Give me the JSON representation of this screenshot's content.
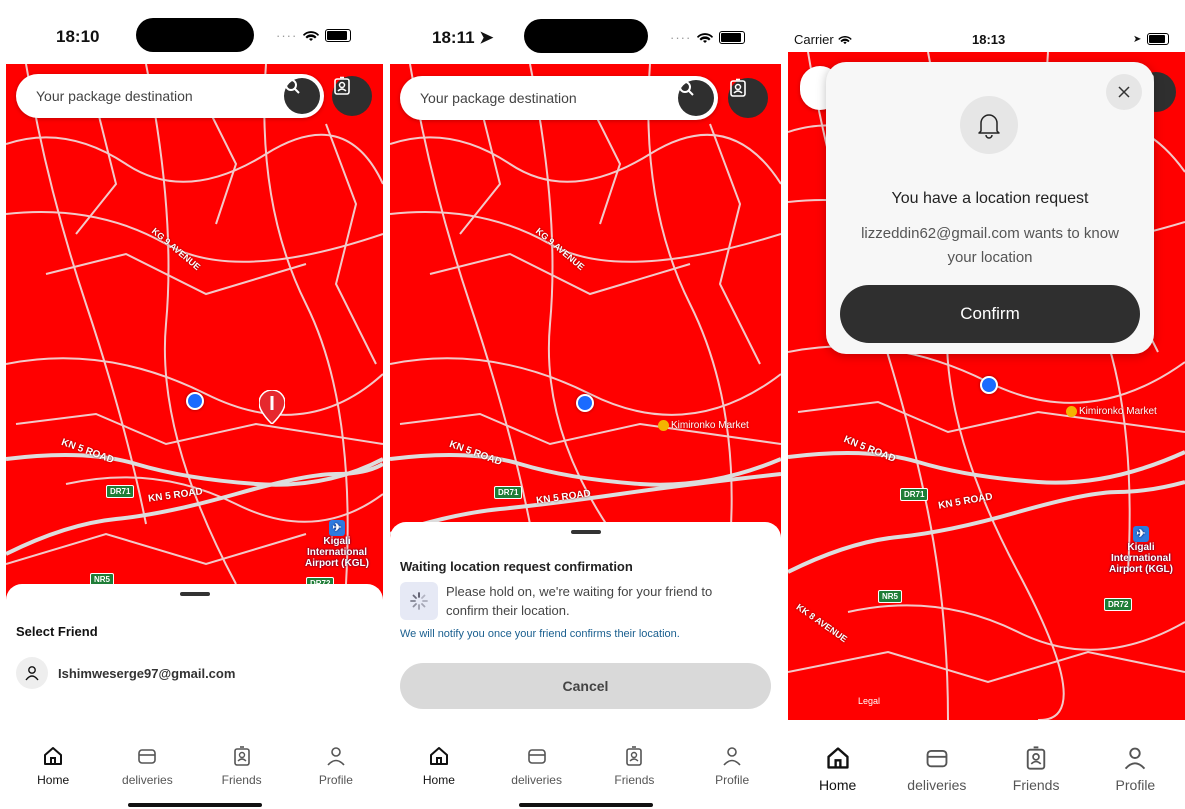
{
  "screens": [
    {
      "time": "18:10",
      "search_placeholder": "Your package destination",
      "map_labels": {
        "kn5_road_a": "KN 5 ROAD",
        "kn5_road_b": "KN 5 ROAD",
        "road_dr71": "DR71",
        "road_nr5": "NR5",
        "road_dr72": "DR72",
        "avenue": "KG 9 AVENUE",
        "airport": "Kigali International Airport (KGL)"
      },
      "sheet": {
        "title": "Select Friend",
        "friend_email": "Ishimweserge97@gmail.com"
      }
    },
    {
      "time": "18:11",
      "search_placeholder": "Your package destination",
      "map_labels": {
        "kn5_road_a": "KN 5 ROAD",
        "kn5_road_b": "KN 5 ROAD",
        "road_dr71": "DR71",
        "market": "Kimironko Market",
        "avenue": "KG 9 AVENUE"
      },
      "sheet": {
        "title": "Waiting location request confirmation",
        "message": "Please hold on, we're waiting for your friend to confirm their location.",
        "note": "We will notify you once your friend confirms their location.",
        "cancel_label": "Cancel"
      }
    },
    {
      "carrier": "Carrier",
      "time": "18:13",
      "map_labels": {
        "kn5_road_a": "KN 5 ROAD",
        "kn5_road_b": "KN 5 ROAD",
        "road_dr71": "DR71",
        "road_nr5": "NR5",
        "road_dr72": "DR72",
        "market": "Kimironko Market",
        "airport": "Kigali International Airport (KGL)",
        "legal": "Legal",
        "avenue": "KK 8 AVENUE"
      },
      "modal": {
        "title": "You have a location request",
        "message": "lizzeddin62@gmail.com wants to know your location",
        "confirm_label": "Confirm"
      }
    }
  ],
  "tabs": [
    "Home",
    "deliveries",
    "Friends",
    "Profile"
  ],
  "colors": {
    "map": "#ff0000",
    "dark_button": "#2f2f2f",
    "link_blue": "#1a5f8f",
    "location_blue": "#1a6bff"
  }
}
